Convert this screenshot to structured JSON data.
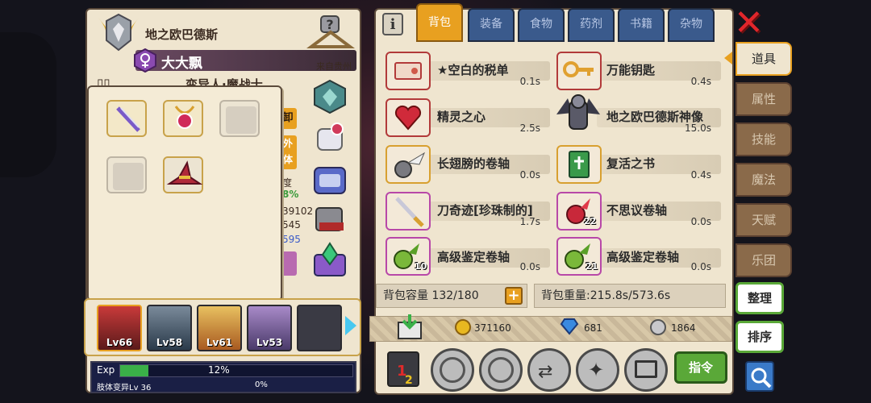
{
  "character": {
    "name": "地之欧巴德斯",
    "title": "大大飘",
    "origin": "来自贵州",
    "class_partial": "变异人·魔战士"
  },
  "side_partial": {
    "btn1": "卸",
    "btn2a": "外",
    "btn2b": "体",
    "stat_label": "度",
    "stat_pct": "8%",
    "num1": "39102",
    "num2": "545",
    "num3": "595"
  },
  "party": {
    "members": [
      {
        "level": "Lv66"
      },
      {
        "level": "Lv58"
      },
      {
        "level": "Lv61"
      },
      {
        "level": "Lv53"
      }
    ]
  },
  "exp": {
    "label": "Exp",
    "percent": "12%",
    "progress": 0.12,
    "mutation_label": "肢体变异Lv 36",
    "mutation_percent": "0%"
  },
  "tabs": [
    "背包",
    "装备",
    "食物",
    "药剂",
    "书籍",
    "杂物"
  ],
  "side_tabs": [
    "道具",
    "属性",
    "技能",
    "魔法",
    "天赋",
    "乐团"
  ],
  "items": [
    {
      "name": "★空白的税单",
      "weight": "0.1s",
      "qty": ""
    },
    {
      "name": "万能钥匙",
      "weight": "0.4s",
      "qty": ""
    },
    {
      "name": "精灵之心",
      "weight": "2.5s",
      "qty": ""
    },
    {
      "name": "地之欧巴德斯神像",
      "weight": "15.0s",
      "qty": ""
    },
    {
      "name": "长翅膀的卷轴",
      "weight": "0.0s",
      "qty": ""
    },
    {
      "name": "复活之书",
      "weight": "0.4s",
      "qty": ""
    },
    {
      "name": "刀奇迹[珍珠制的]",
      "weight": "1.7s",
      "qty": ""
    },
    {
      "name": "不思议卷轴",
      "weight": "0.0s",
      "qty": "22"
    },
    {
      "name": "高级鉴定卷轴",
      "weight": "0.0s",
      "qty": "10"
    },
    {
      "name": "高级鉴定卷轴",
      "weight": "0.0s",
      "qty": "21"
    }
  ],
  "capacity": "背包容量 132/180",
  "weight": "背包重量:215.8s/573.6s",
  "currency": {
    "gold": "371160",
    "diamond": "681",
    "silver": "1864"
  },
  "buttons": {
    "sort": "整理",
    "order": "排序",
    "command": "指令"
  },
  "colors": {
    "tab_active": "#e8a020",
    "tab_inactive": "#3a5a8c",
    "close": "#e0262b",
    "green_button": "#5aa838"
  }
}
